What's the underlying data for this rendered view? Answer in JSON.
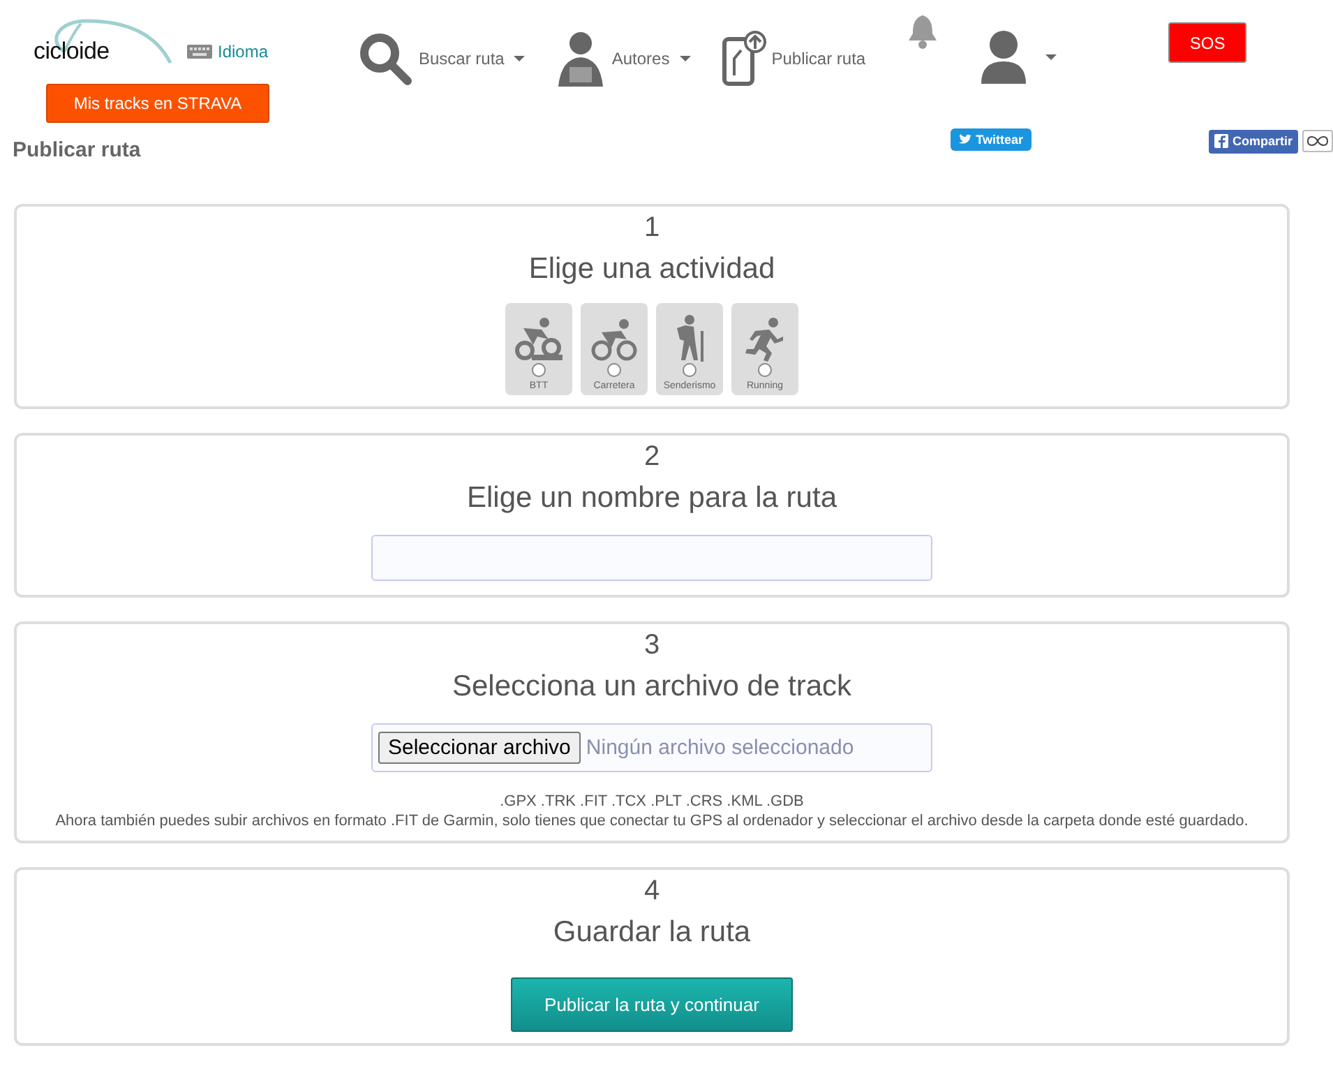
{
  "header": {
    "logo": "cicloide",
    "language_link": "Idioma",
    "strava_button": "Mis tracks en STRAVA",
    "nav": [
      {
        "label": "Buscar ruta",
        "kind": "search",
        "dropdown": true
      },
      {
        "label": "Autores",
        "kind": "author",
        "dropdown": true
      },
      {
        "label": "Publicar ruta",
        "kind": "phone",
        "dropdown": false
      }
    ],
    "sos_button": "SOS"
  },
  "page_title": "Publicar ruta",
  "share": {
    "twitter": "Twittear",
    "facebook": "Compartir"
  },
  "steps": [
    {
      "number": "1",
      "title": "Elige una actividad",
      "kind": "activities",
      "activities": [
        {
          "label": "BTT",
          "kind": "mtb",
          "selected": false
        },
        {
          "label": "Carretera",
          "kind": "road",
          "selected": false
        },
        {
          "label": "Senderismo",
          "kind": "hike",
          "selected": false
        },
        {
          "label": "Running",
          "kind": "run",
          "selected": false
        }
      ]
    },
    {
      "number": "2",
      "title": "Elige un nombre para la ruta",
      "kind": "text_input"
    },
    {
      "number": "3",
      "title": "Selecciona un archivo de track",
      "kind": "file_input",
      "file_button": "Seleccionar archivo",
      "file_status": "Ningún archivo seleccionado",
      "formats": ".GPX .TRK .FIT .TCX .PLT .CRS .KML .GDB",
      "note": "Ahora también puedes subir archivos en formato .FIT de Garmin, solo tienes que conectar tu GPS al ordenador y seleccionar el archivo desde la carpeta donde esté guardado."
    },
    {
      "number": "4",
      "title": "Guardar la ruta",
      "kind": "submit",
      "button": "Publicar la ruta y continuar"
    }
  ]
}
